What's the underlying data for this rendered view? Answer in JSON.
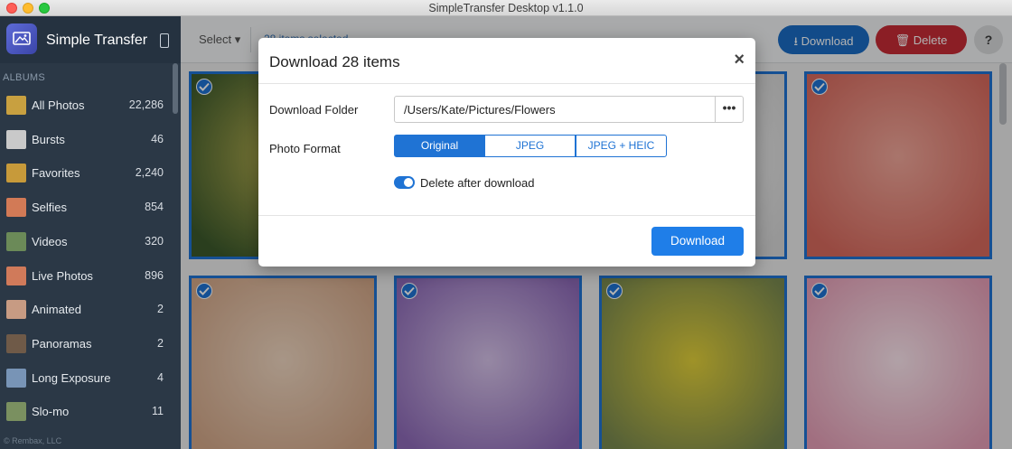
{
  "window": {
    "title": "SimpleTransfer Desktop v1.1.0"
  },
  "sidebar": {
    "brand": "Simple Transfer",
    "albums_header": "ALBUMS",
    "albums": [
      {
        "name": "All Photos",
        "count": "22,286",
        "color": "#c8a040"
      },
      {
        "name": "Bursts",
        "count": "46",
        "color": "#c9c9c9"
      },
      {
        "name": "Favorites",
        "count": "2,240",
        "color": "#c79a3a"
      },
      {
        "name": "Selfies",
        "count": "854",
        "color": "#d27a56"
      },
      {
        "name": "Videos",
        "count": "320",
        "color": "#6b8a58"
      },
      {
        "name": "Live Photos",
        "count": "896",
        "color": "#d07a5a"
      },
      {
        "name": "Animated",
        "count": "2",
        "color": "#c79b83"
      },
      {
        "name": "Panoramas",
        "count": "2",
        "color": "#6f5a48"
      },
      {
        "name": "Long Exposure",
        "count": "4",
        "color": "#7894b6"
      },
      {
        "name": "Slo-mo",
        "count": "11",
        "color": "#7a9060"
      }
    ],
    "footer": "© Rembax, LLC"
  },
  "toolbar": {
    "select_label": "Select ▾",
    "selected_text": "28 items selected",
    "download_label": "Download",
    "delete_label": "Delete",
    "help_label": "?"
  },
  "grid": {
    "tiles": [
      {
        "color1": "#3d5a2c",
        "color2": "#b9b150"
      },
      {
        "color1": "#a0a0a0",
        "color2": "#e5e5e5"
      },
      {
        "color1": "#d9d9d9",
        "color2": "#f4f4f4"
      },
      {
        "color1": "#d96a5e",
        "color2": "#f2a89b"
      },
      {
        "color1": "#d4a889",
        "color2": "#f0d7c1"
      },
      {
        "color1": "#8e6ab8",
        "color2": "#d7c3ea"
      },
      {
        "color1": "#7a8a50",
        "color2": "#e4d23a"
      },
      {
        "color1": "#e7a0b8",
        "color2": "#fde7ef"
      }
    ]
  },
  "modal": {
    "title": "Download 28 items",
    "close": "×",
    "folder_label": "Download Folder",
    "folder_value": "/Users/Kate/Pictures/Flowers",
    "browse_label": "•••",
    "format_label": "Photo Format",
    "formats": [
      "Original",
      "JPEG",
      "JPEG + HEIC"
    ],
    "selected_format": "Original",
    "delete_after_label": "Delete after download",
    "delete_after_enabled": true,
    "download_label": "Download"
  },
  "colors": {
    "accent": "#1f73d4",
    "delete_red": "#c72c35",
    "sidebar_bg": "#2b3846"
  }
}
